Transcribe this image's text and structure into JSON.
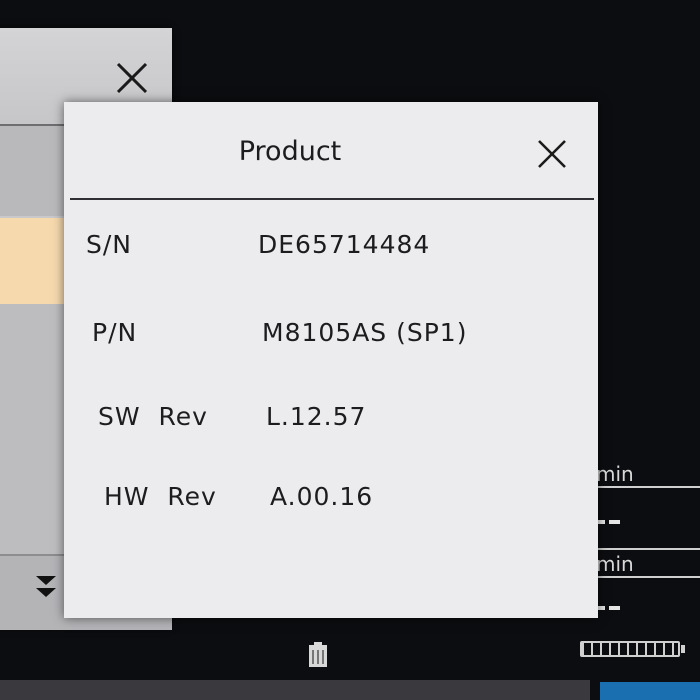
{
  "background_window": {
    "close_icon": "close-icon",
    "expand_icon": "double-chevron-down-icon",
    "highlight_color": "#f6d9ad"
  },
  "dialog": {
    "title": "Product",
    "close_icon": "close-icon",
    "fields": [
      {
        "label": "S/N",
        "value": "DE65714484"
      },
      {
        "label": "P/N",
        "value": "M8105AS (SP1)"
      },
      {
        "label": "SW  Rev",
        "value": "L.12.57"
      },
      {
        "label": "HW  Rev",
        "value": "A.00.16"
      }
    ]
  },
  "side_readouts": [
    {
      "unit": "min"
    },
    {
      "unit": "min"
    }
  ],
  "status_bar": {
    "battery_icon": "battery-icon"
  }
}
